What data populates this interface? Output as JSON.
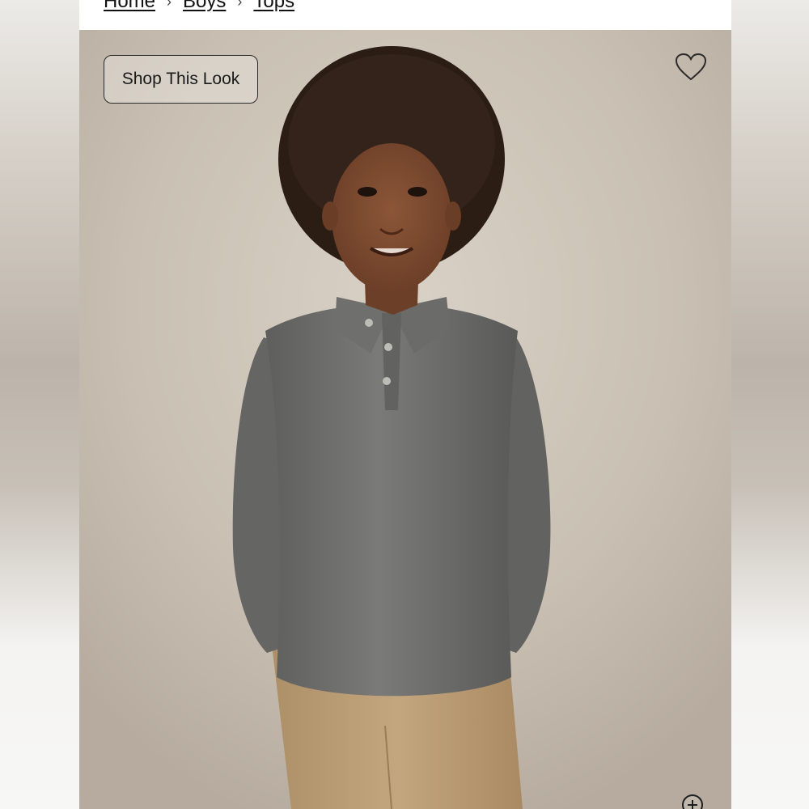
{
  "breadcrumb": {
    "items": [
      "Home",
      "Boys",
      "Tops"
    ]
  },
  "hero": {
    "shop_look_label": "Shop This Look"
  },
  "colors": {
    "page_bg": "#ffffff",
    "hero_bg": "#cbc2b6",
    "shirt": "#6c6c6a",
    "pants": "#bfa27a",
    "hair": "#2b1d14",
    "skin": "#7a4a30"
  },
  "icons": {
    "favorite": "heart-icon",
    "zoom": "zoom-plus-icon",
    "separator": "chevron-right-icon"
  }
}
